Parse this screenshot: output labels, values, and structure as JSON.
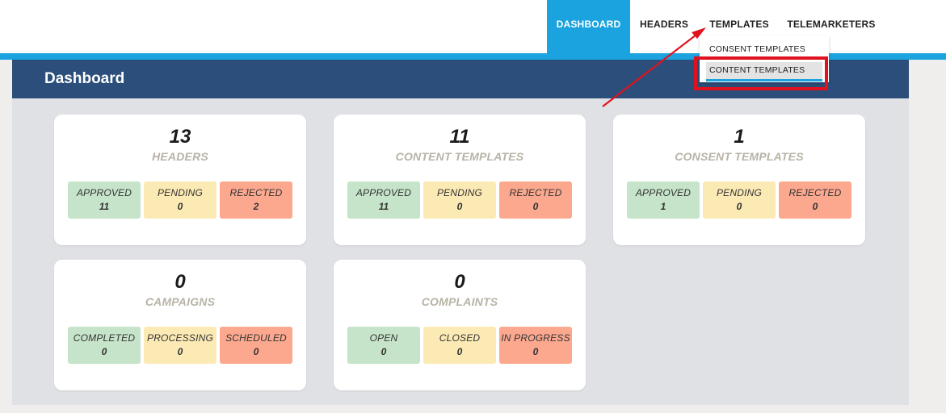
{
  "nav": {
    "dashboard": "DASHBOARD",
    "headers": "HEADERS",
    "templates": "TEMPLATES",
    "telemarketers": "TELEMARKETERS"
  },
  "dropdown": {
    "items": [
      "CONSENT TEMPLATES",
      "CONTENT TEMPLATES"
    ]
  },
  "main": {
    "title": "Dashboard"
  },
  "cards": [
    {
      "count": "13",
      "label": "HEADERS",
      "stats": [
        {
          "label": "APPROVED",
          "value": "11"
        },
        {
          "label": "PENDING",
          "value": "0"
        },
        {
          "label": "REJECTED",
          "value": "2"
        }
      ]
    },
    {
      "count": "11",
      "label": "CONTENT TEMPLATES",
      "stats": [
        {
          "label": "APPROVED",
          "value": "11"
        },
        {
          "label": "PENDING",
          "value": "0"
        },
        {
          "label": "REJECTED",
          "value": "0"
        }
      ]
    },
    {
      "count": "1",
      "label": "CONSENT TEMPLATES",
      "stats": [
        {
          "label": "APPROVED",
          "value": "1"
        },
        {
          "label": "PENDING",
          "value": "0"
        },
        {
          "label": "REJECTED",
          "value": "0"
        }
      ]
    },
    {
      "count": "0",
      "label": "CAMPAIGNS",
      "stats": [
        {
          "label": "COMPLETED",
          "value": "0"
        },
        {
          "label": "PROCESSING",
          "value": "0"
        },
        {
          "label": "SCHEDULED",
          "value": "0"
        }
      ]
    },
    {
      "count": "0",
      "label": "COMPLAINTS",
      "stats": [
        {
          "label": "OPEN",
          "value": "0"
        },
        {
          "label": "CLOSED",
          "value": "0"
        },
        {
          "label": "IN PROGRESS",
          "value": "0"
        }
      ]
    }
  ],
  "colors": {
    "nav_active": "#1aa3df",
    "header_bar": "#2b4e7a",
    "status_green": "#c6e4c9",
    "status_yellow": "#fceab5",
    "status_red": "#fba88f",
    "annotation": "#e0121e"
  },
  "icons": [
    "annotation-arrow-icon"
  ]
}
